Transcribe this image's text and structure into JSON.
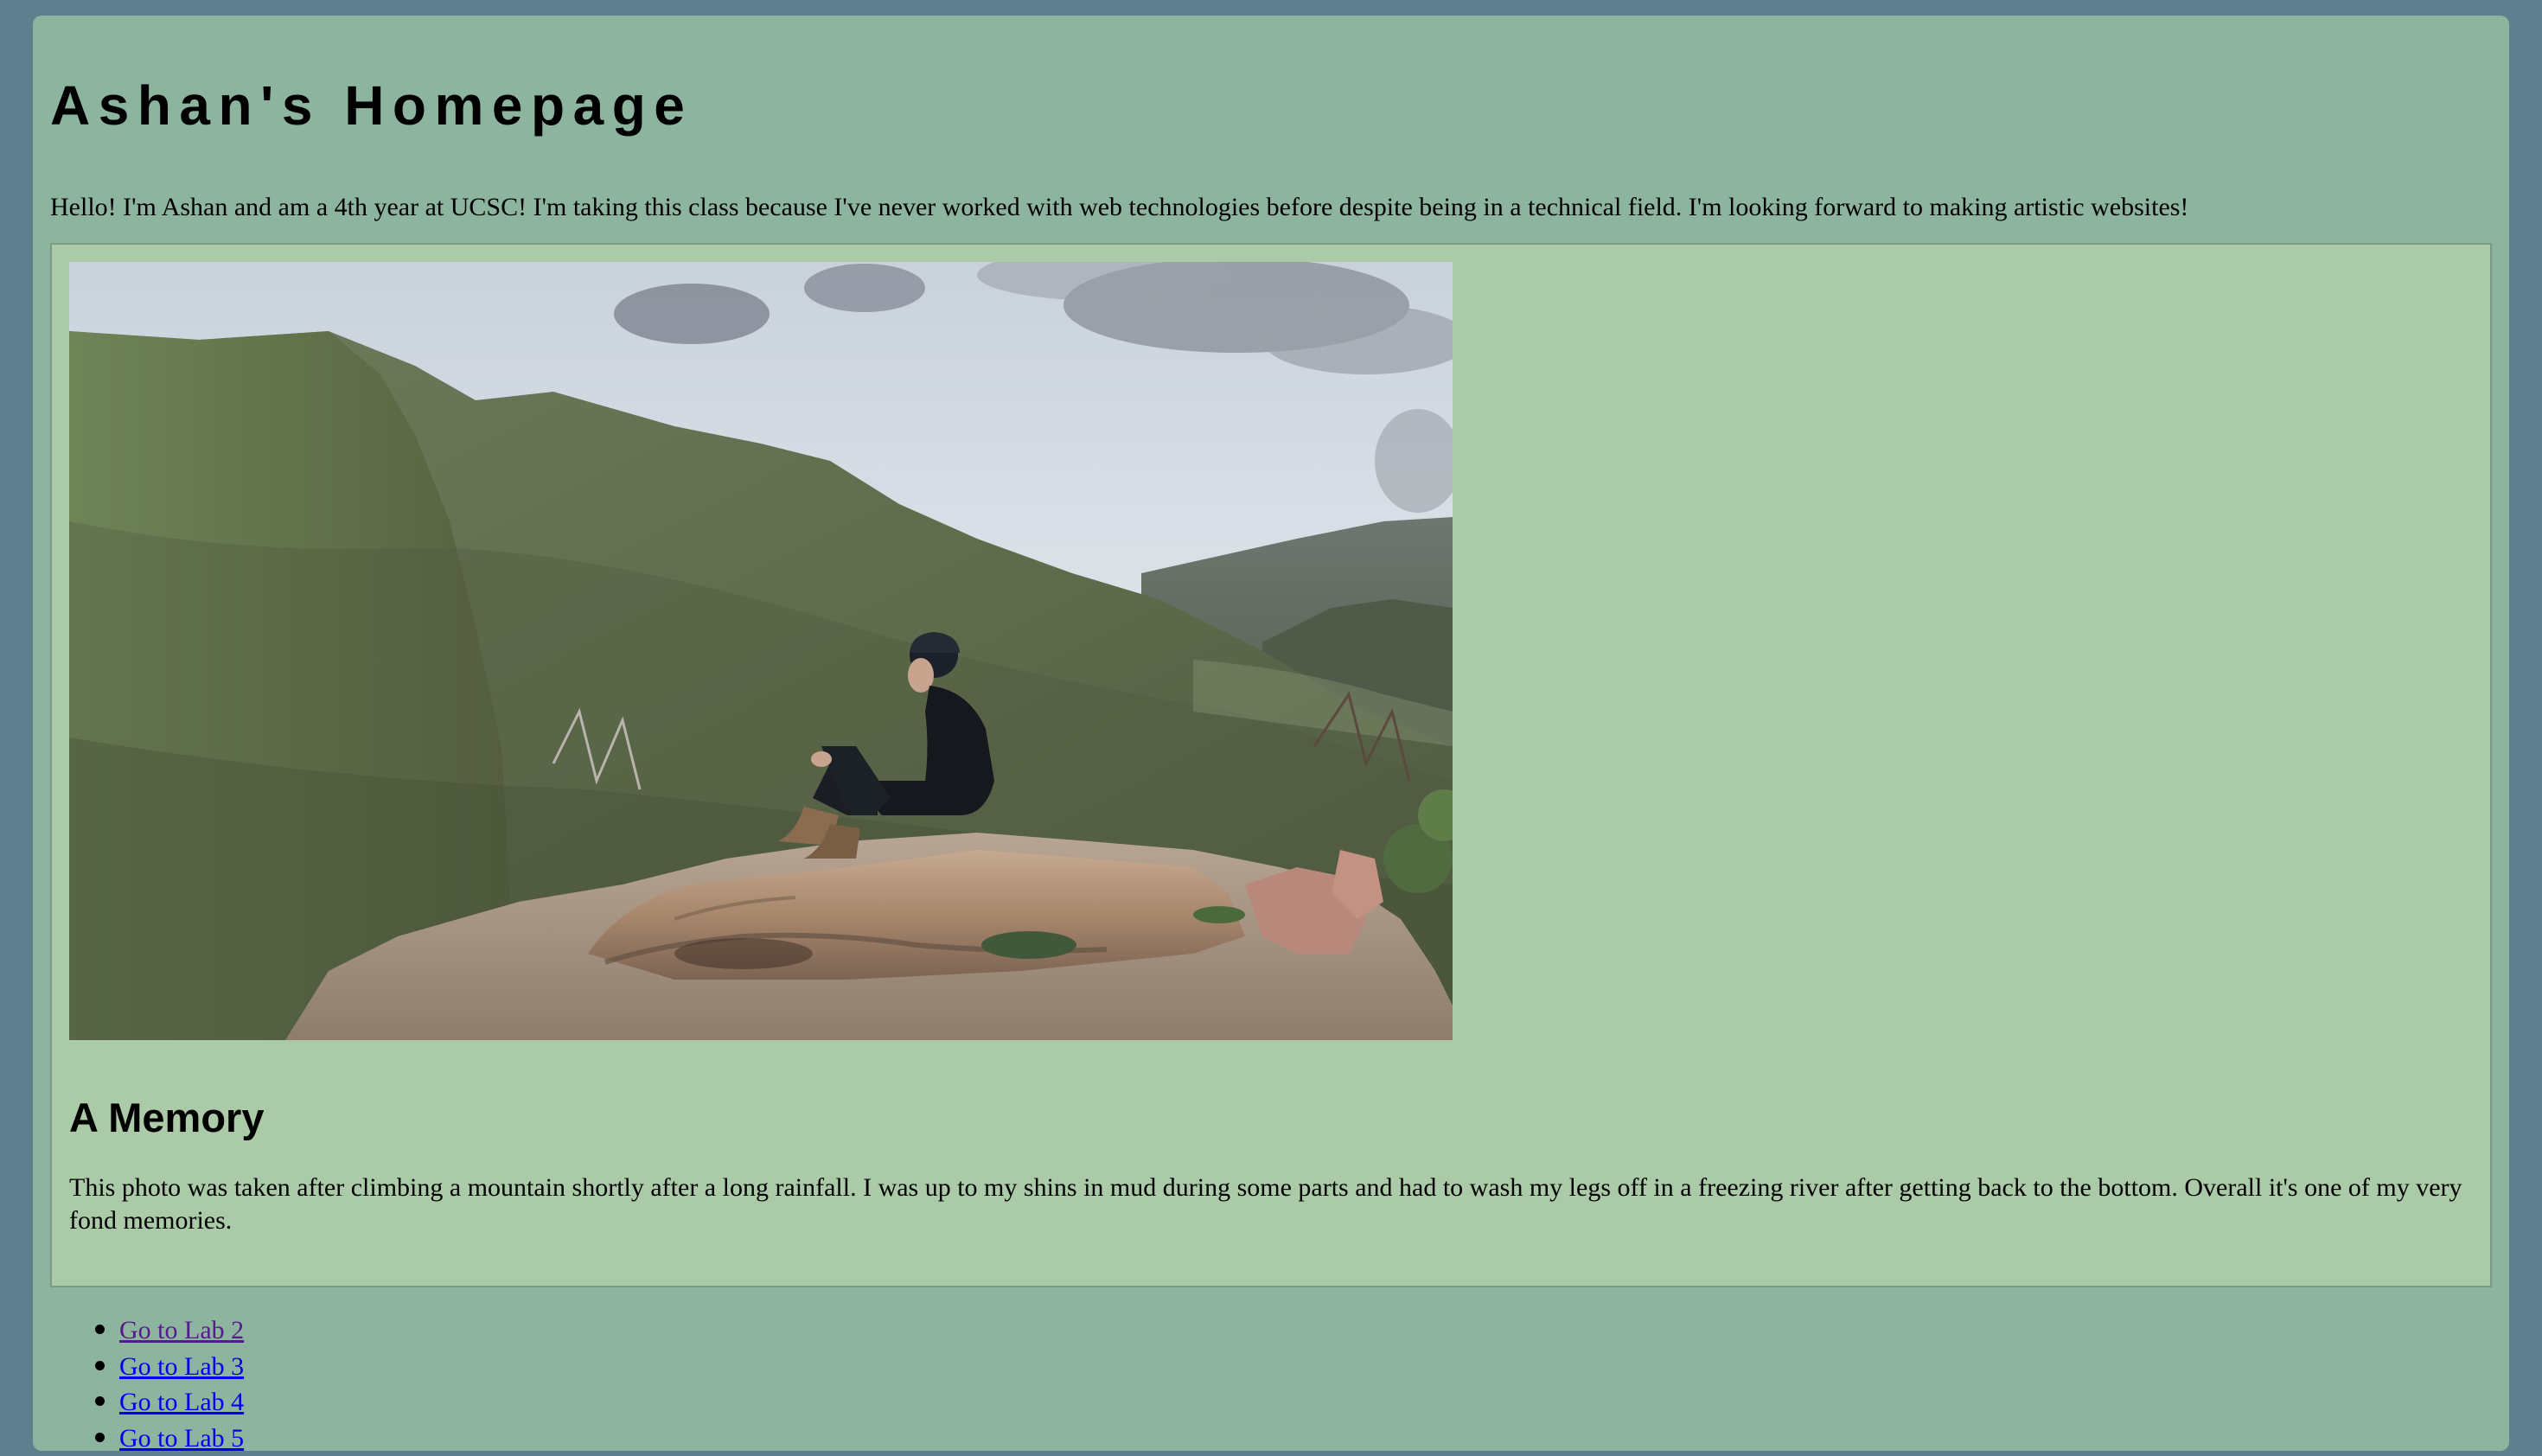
{
  "page": {
    "title": "Ashan's Homepage",
    "intro": "Hello! I'm Ashan and am a 4th year at UCSC! I'm taking this class because I've never worked with web technologies before despite being in a technical field. I'm looking forward to making artistic websites!"
  },
  "memory": {
    "heading": "A Memory",
    "text": "This photo was taken after climbing a mountain shortly after a long rainfall. I was up to my shins in mud during some parts and had to wash my legs off in a freezing river after getting back to the bottom. Overall it's one of my very fond memories."
  },
  "links": [
    {
      "label": "Go to Lab 2",
      "visited": true
    },
    {
      "label": "Go to Lab 3",
      "visited": false
    },
    {
      "label": "Go to Lab 4",
      "visited": false
    },
    {
      "label": "Go to Lab 5",
      "visited": false
    }
  ],
  "colors": {
    "frame": "#5e7f8d",
    "page": "#8db49e",
    "card": "#aacaa8",
    "link": "#0000ee",
    "visited_link": "#551a8b"
  }
}
